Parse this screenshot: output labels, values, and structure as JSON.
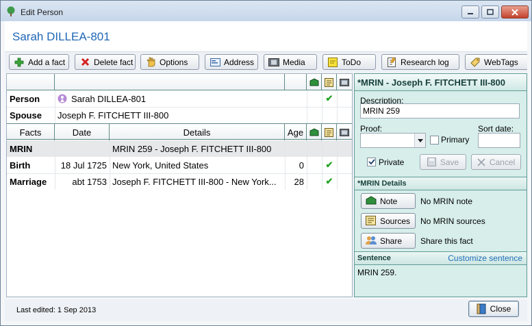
{
  "window": {
    "title": "Edit Person"
  },
  "header": {
    "person_name": "Sarah DILLEA-801"
  },
  "toolbar": {
    "buttons": [
      {
        "label": "Add a fact",
        "icon": "plus-icon"
      },
      {
        "label": "Delete fact",
        "icon": "delete-x-icon"
      },
      {
        "label": "Options",
        "icon": "options-hand-icon"
      },
      {
        "label": "Address",
        "icon": "address-card-icon"
      },
      {
        "label": "Media",
        "icon": "film-icon"
      },
      {
        "label": "ToDo",
        "icon": "todo-note-icon"
      },
      {
        "label": "Research log",
        "icon": "research-log-icon"
      },
      {
        "label": "WebTags",
        "icon": "webtags-icon"
      }
    ]
  },
  "people": [
    {
      "label": "Person",
      "value": "Sarah DILLEA-801",
      "has_source": true
    },
    {
      "label": "Spouse",
      "value": "Joseph F. FITCHETT III-800",
      "has_source": false
    }
  ],
  "facts_table": {
    "headers": [
      "Facts",
      "Date",
      "Details",
      "Age"
    ],
    "rows": [
      {
        "fact": "MRIN",
        "date": "",
        "details": "MRIN 259 - Joseph F. FITCHETT III-800",
        "age": "",
        "sourced": false,
        "selected": true
      },
      {
        "fact": "Birth",
        "date": "18 Jul 1725",
        "details": "New York, United States",
        "age": "0",
        "sourced": true,
        "selected": false
      },
      {
        "fact": "Marriage",
        "date": "abt 1753",
        "details": "Joseph F. FITCHETT III-800 - New York...",
        "age": "28",
        "sourced": true,
        "selected": false
      }
    ]
  },
  "detail": {
    "title": "*MRIN - Joseph F. FITCHETT III-800",
    "description_label": "Description:",
    "description_value": "MRIN 259",
    "proof_label": "Proof:",
    "proof_value": "",
    "primary_label": "Primary",
    "sort_date_label": "Sort date:",
    "sort_date_value": "",
    "private_label": "Private",
    "private_checked": true,
    "save_label": "Save",
    "cancel_label": "Cancel",
    "details_section_title": "*MRIN Details",
    "note_button": "Note",
    "note_text": "No MRIN note",
    "sources_button": "Sources",
    "sources_text": "No MRIN sources",
    "share_button": "Share",
    "share_text": "Share this fact",
    "sentence_label": "Sentence",
    "customize_link": "Customize sentence",
    "sentence_text": "MRIN 259."
  },
  "footer": {
    "last_edited": "Last edited: 1 Sep 2013",
    "close_label": "Close"
  },
  "colors": {
    "accent": "#1e66b5",
    "panel": "#d7eeea",
    "check": "#22a326"
  }
}
